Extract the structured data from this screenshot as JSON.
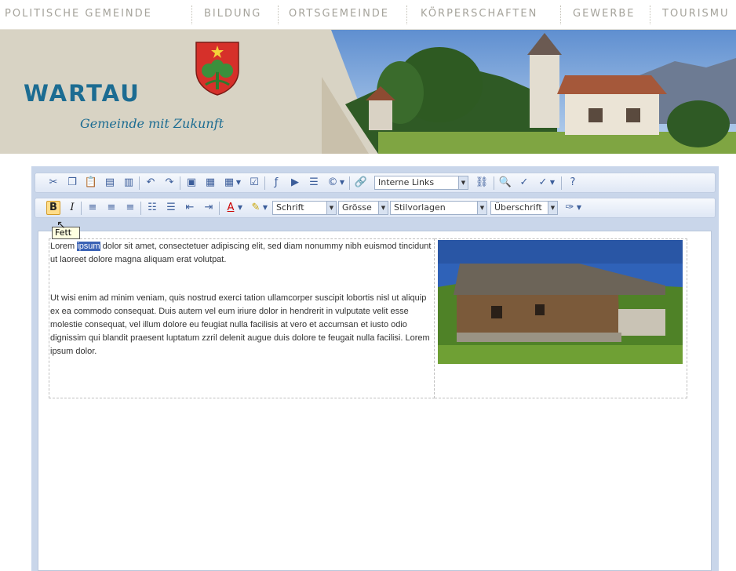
{
  "nav": {
    "items": [
      "POLITISCHE GEMEINDE",
      "BILDUNG",
      "ORTSGEMEINDE",
      "KÖRPERSCHAFTEN",
      "GEWERBE",
      "TOURISMU"
    ]
  },
  "banner": {
    "brand": "WARTAU",
    "slogan": "Gemeinde mit Zukunft",
    "colors": {
      "brand": "#1c6c92",
      "background": "#d8d3c4"
    }
  },
  "toolbar": {
    "row1_dropdowns": {
      "links": "Interne Links"
    },
    "row2_dropdowns": {
      "font": "Schrift",
      "size": "Grösse",
      "styles": "Stilvorlagen",
      "heading": "Überschrift"
    },
    "bold_label": "B",
    "italic_label": "I",
    "tooltip": "Fett"
  },
  "content": {
    "p1_before": "Lorem ",
    "p1_selected": "ipsum",
    "p1_after": " dolor sit amet, consectetuer adipiscing elit, sed diam nonummy nibh euismod tincidunt ut laoreet dolore magna aliquam erat volutpat.",
    "p2": "Ut wisi enim ad minim veniam, quis nostrud exerci tation ullamcorper suscipit lobortis nisl ut aliquip ex ea commodo consequat. Duis autem vel eum iriure dolor in hendrerit in vulputate velit esse molestie consequat, vel illum dolore eu feugiat nulla facilisis at vero et accumsan et iusto odio dignissim qui blandit praesent luptatum zzril delenit augue duis dolore te feugait nulla facilisi. Lorem ipsum dolor."
  }
}
